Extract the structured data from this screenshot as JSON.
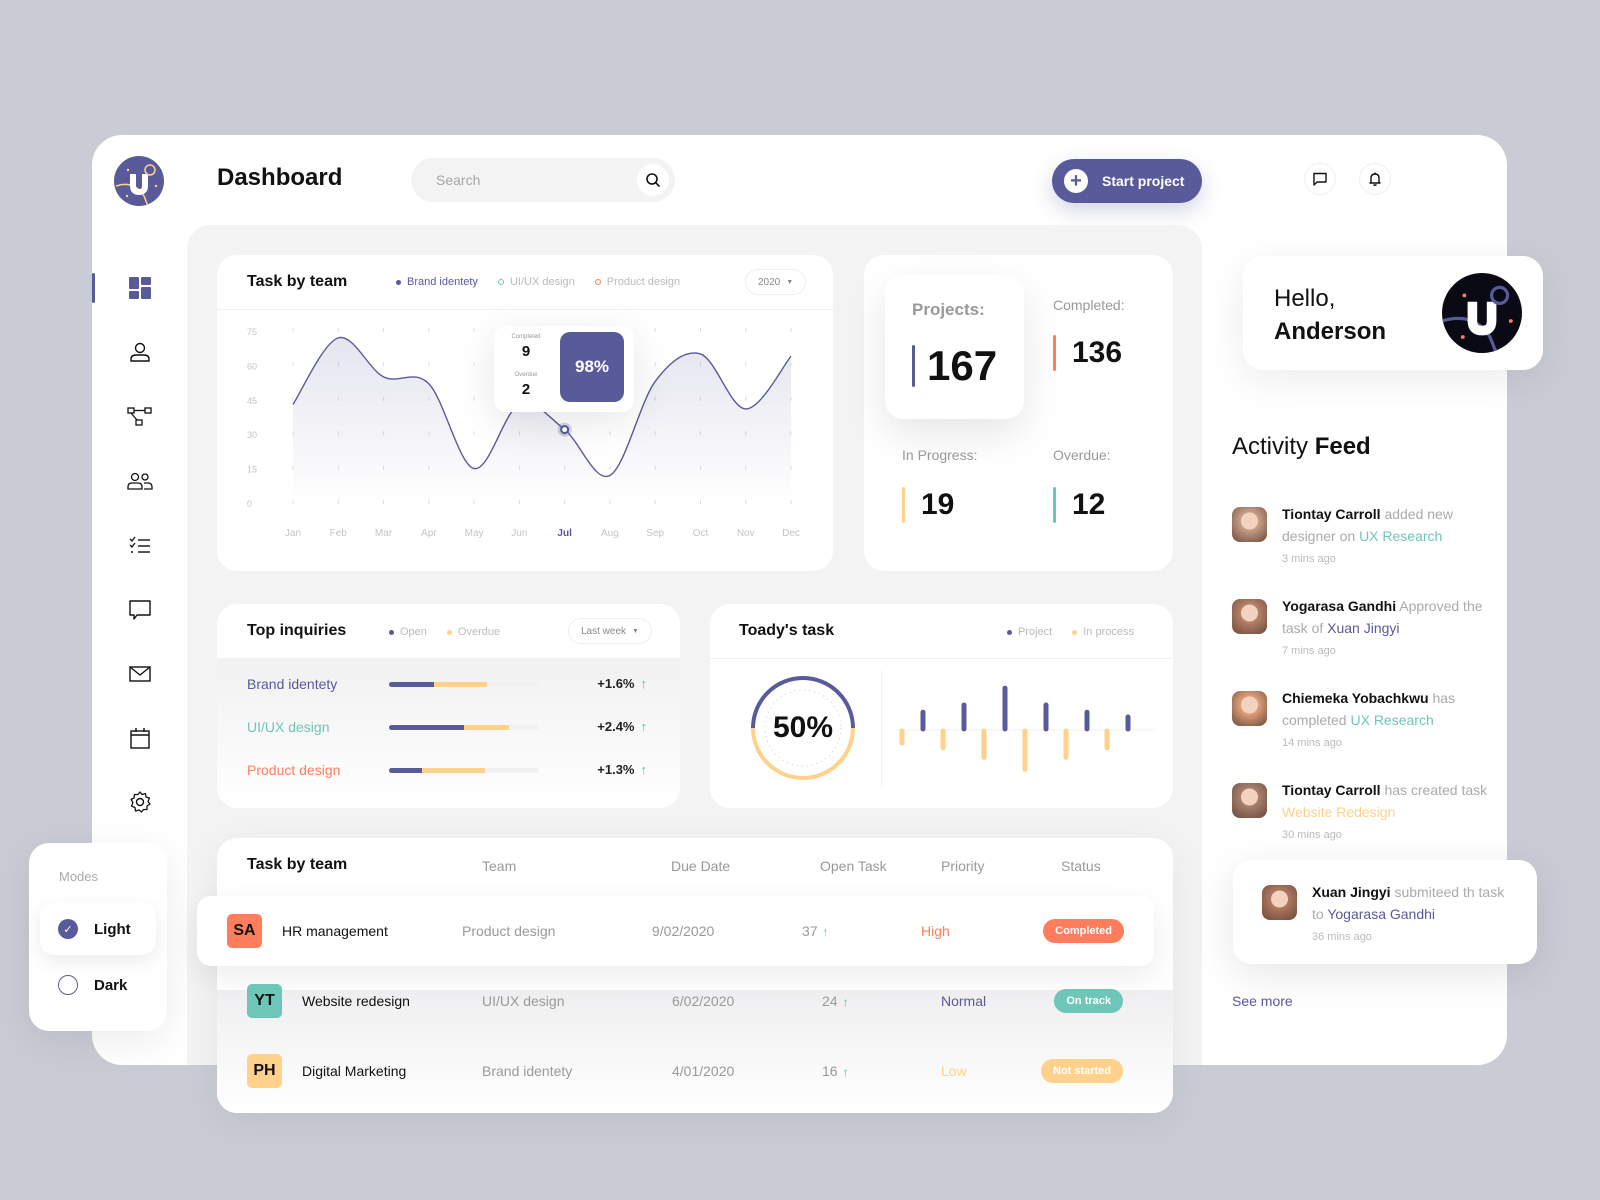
{
  "header": {
    "title": "Dashboard",
    "search_placeholder": "Search",
    "start_project_label": "Start project"
  },
  "sidebar": {
    "items": [
      {
        "name": "dashboard",
        "active": true
      },
      {
        "name": "profile"
      },
      {
        "name": "workflow"
      },
      {
        "name": "team"
      },
      {
        "name": "tasks"
      },
      {
        "name": "messages"
      },
      {
        "name": "mail"
      },
      {
        "name": "calendar"
      },
      {
        "name": "settings"
      }
    ]
  },
  "modes": {
    "title": "Modes",
    "options": [
      {
        "label": "Light",
        "selected": true
      },
      {
        "label": "Dark",
        "selected": false
      }
    ]
  },
  "task_chart": {
    "title": "Task by team",
    "legend": [
      "Brand identety",
      "UI/UX design",
      "Product design"
    ],
    "year": "2020",
    "tooltip": {
      "completed_label": "Completed",
      "completed_value": "9",
      "overdue_label": "Overdue",
      "overdue_value": "2",
      "percent": "98%"
    }
  },
  "chart_data": {
    "type": "area",
    "title": "Task by team",
    "x": [
      "Jan",
      "Feb",
      "Mar",
      "Apr",
      "May",
      "Jun",
      "Jul",
      "Aug",
      "Sep",
      "Oct",
      "Nov",
      "Dec"
    ],
    "series": [
      {
        "name": "Brand identety",
        "values": [
          43,
          72,
          55,
          52,
          15,
          43,
          32,
          12,
          53,
          65,
          41,
          64
        ]
      }
    ],
    "yticks": [
      0,
      15,
      30,
      45,
      60,
      75
    ],
    "ylim": [
      0,
      75
    ],
    "highlight": "Jul",
    "grid": true,
    "legend_position": "top"
  },
  "stats": {
    "projects_label": "Projects:",
    "projects_value": "167",
    "completed_label": "Completed:",
    "completed_value": "136",
    "in_progress_label": "In Progress:",
    "in_progress_value": "19",
    "overdue_label": "Overdue:",
    "overdue_value": "12"
  },
  "inquiries": {
    "title": "Top inquiries",
    "legend": [
      "Open",
      "Overdue"
    ],
    "period": "Last week",
    "rows": [
      {
        "name": "Brand identety",
        "open": 0.3,
        "overdue": 0.35,
        "change": "+1.6%",
        "color": "#585a9a"
      },
      {
        "name": "UI/UX design",
        "open": 0.5,
        "overdue": 0.3,
        "change": "+2.4%",
        "color": "#6ec6b8"
      },
      {
        "name": "Product design",
        "open": 0.22,
        "overdue": 0.42,
        "change": "+1.3%",
        "color": "#ff7d5c"
      }
    ]
  },
  "today_task": {
    "title": "Toady's task",
    "legend": [
      "Project",
      "In process"
    ],
    "percent": "50%",
    "progress": 0.5,
    "project_bars": [
      0.35,
      0.5,
      0.85,
      0.5,
      0.35,
      0.25
    ],
    "process_bars": [
      0.25,
      0.35,
      0.55,
      0.8,
      0.55,
      0.35
    ]
  },
  "table": {
    "title": "Task by team",
    "columns": [
      "Team",
      "Due Date",
      "Open Task",
      "Priority",
      "Status"
    ],
    "rows": [
      {
        "initials": "SA",
        "name": "HR management",
        "team": "Product design",
        "due": "9/02/2020",
        "open": "37",
        "priority": "High",
        "status": "Completed",
        "avatar_color": "#ff7d5c",
        "priority_color": "#ff7d5c",
        "status_color": "#ff7d5c"
      },
      {
        "initials": "YT",
        "name": "Website redesign",
        "team": "UI/UX design",
        "due": "6/02/2020",
        "open": "24",
        "priority": "Normal",
        "status": "On track",
        "avatar_color": "#6ec6b8",
        "priority_color": "#585a9a",
        "status_color": "#6ec6b8"
      },
      {
        "initials": "PH",
        "name": "Digital Marketing",
        "team": "Brand identety",
        "due": "4/01/2020",
        "open": "16",
        "priority": "Low",
        "status": "Not started",
        "avatar_color": "#ffd18a",
        "priority_color": "#ffd18a",
        "status_color": "#ffd18a"
      }
    ]
  },
  "greeting": {
    "hello": "Hello,",
    "name": "Anderson"
  },
  "feed": {
    "title_light": "Activity",
    "title_bold": "Feed",
    "items": [
      {
        "user": "Tiontay Carroll",
        "action": "added new designer on",
        "target": "UX Research",
        "target_color": "#6ec6b8",
        "time": "3 mins ago"
      },
      {
        "user": "Yogarasa Gandhi",
        "action": "Approved the task of",
        "target": "Xuan Jingyi",
        "target_color": "#585a9a",
        "time": "7 mins ago"
      },
      {
        "user": "Chiemeka Yobachkwu",
        "action": "has completed",
        "target": "UX Research",
        "target_color": "#6ec6b8",
        "time": "14 mins ago"
      },
      {
        "user": "Tiontay Carroll",
        "action": "has created task",
        "target": "Website Redesign",
        "target_color": "#ffd18a",
        "time": "30 mins ago"
      },
      {
        "user": "Xuan Jingyi",
        "action": "submiteed th task to",
        "target": "Yogarasa Gandhi",
        "target_color": "#585a9a",
        "time": "36 mins ago"
      }
    ],
    "see_more": "See more"
  },
  "colors": {
    "accent": "#585a9a",
    "orange": "#ff7d5c",
    "yellow": "#ffd18a",
    "teal": "#6ec6b8",
    "green": "#3dd18a"
  }
}
